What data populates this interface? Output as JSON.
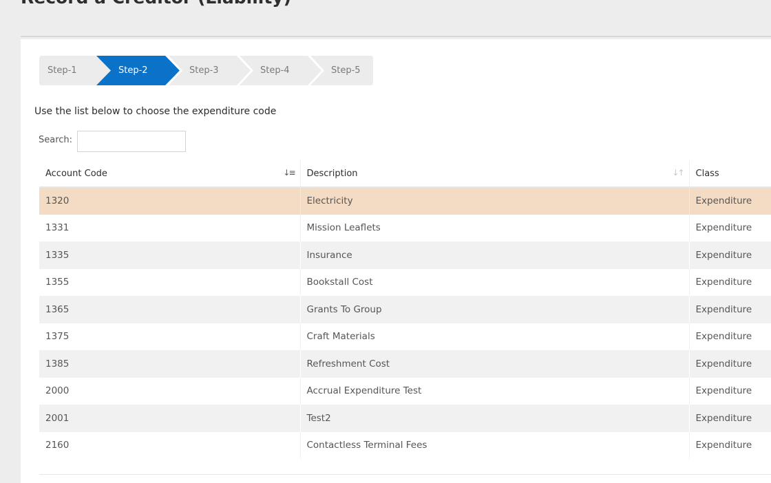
{
  "page": {
    "title": "Record a Creditor (Liability)"
  },
  "stepper": {
    "steps": [
      {
        "label": "Step-1",
        "active": false
      },
      {
        "label": "Step-2",
        "active": true
      },
      {
        "label": "Step-3",
        "active": false
      },
      {
        "label": "Step-4",
        "active": false
      },
      {
        "label": "Step-5",
        "active": false
      }
    ],
    "active_color": "#0a73c9"
  },
  "instruction": "Use the list below to choose the expenditure code",
  "search": {
    "label": "Search:",
    "value": "",
    "placeholder": ""
  },
  "table": {
    "columns": [
      "Account Code",
      "Description",
      "Class"
    ],
    "sorted_column": "Account Code",
    "rows": [
      {
        "code": "1320",
        "description": "Electricity",
        "class": "Expenditure",
        "selected": true
      },
      {
        "code": "1331",
        "description": "Mission Leaflets",
        "class": "Expenditure",
        "selected": false
      },
      {
        "code": "1335",
        "description": "Insurance",
        "class": "Expenditure",
        "selected": false
      },
      {
        "code": "1355",
        "description": "Bookstall Cost",
        "class": "Expenditure",
        "selected": false
      },
      {
        "code": "1365",
        "description": "Grants To Group",
        "class": "Expenditure",
        "selected": false
      },
      {
        "code": "1375",
        "description": "Craft Materials",
        "class": "Expenditure",
        "selected": false
      },
      {
        "code": "1385",
        "description": "Refreshment Cost",
        "class": "Expenditure",
        "selected": false
      },
      {
        "code": "2000",
        "description": "Accrual Expenditure Test",
        "class": "Expenditure",
        "selected": false
      },
      {
        "code": "2001",
        "description": "Test2",
        "class": "Expenditure",
        "selected": false
      },
      {
        "code": "2160",
        "description": "Contactless Terminal Fees",
        "class": "Expenditure",
        "selected": false
      }
    ],
    "selected_row_color": "#f4dbc4"
  },
  "icons": {
    "sort_active": "sort-amount-down-icon",
    "sort_inactive": "sort-both-icon"
  }
}
